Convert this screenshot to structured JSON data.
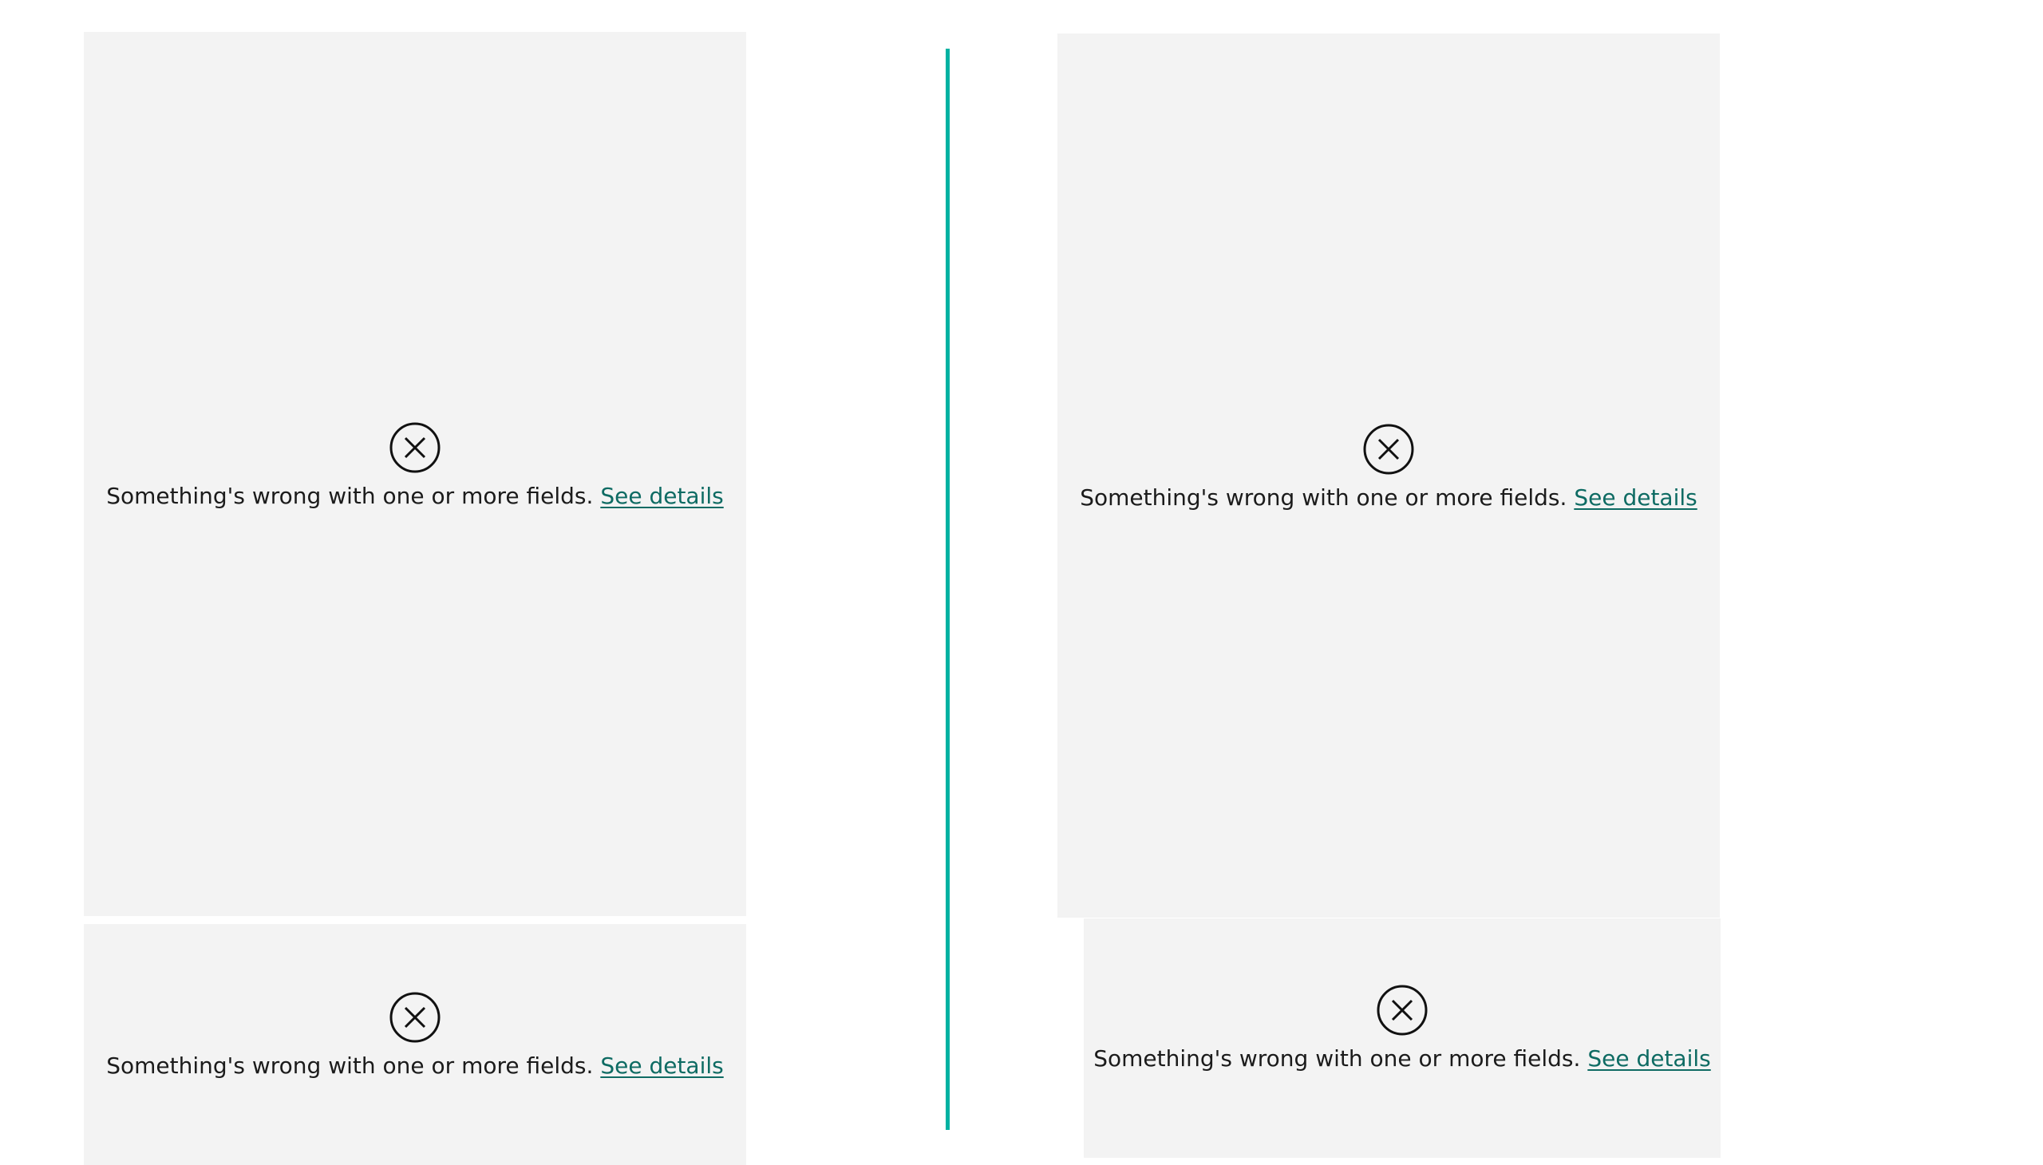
{
  "colors": {
    "panel_background": "#f3f3f3",
    "divider": "#00b2a2",
    "link": "#0e6b63",
    "text": "#1b1b1b"
  },
  "panels": [
    {
      "icon": "error-circle-x-icon",
      "message": "Something's wrong with one or more fields.",
      "link_label": "See details"
    },
    {
      "icon": "error-circle-x-icon",
      "message": "Something's wrong with one or more fields.",
      "link_label": "See details"
    },
    {
      "icon": "error-circle-x-icon",
      "message": "Something's wrong with one or more fields.",
      "link_label": "See details"
    },
    {
      "icon": "error-circle-x-icon",
      "message": "Something's wrong with one or more fields.",
      "link_label": "See details"
    }
  ]
}
